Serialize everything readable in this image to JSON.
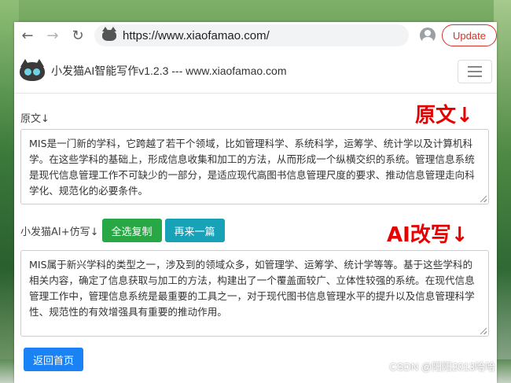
{
  "browser": {
    "back_icon": "←",
    "forward_icon": "→",
    "reload_icon": "↻",
    "url": "https://www.xiaofamao.com/",
    "update_label": "Update"
  },
  "site": {
    "brand": "小发猫AI智能写作v1.2.3 --- www.xiaofamao.com"
  },
  "original": {
    "label": "原文↓",
    "big_label": "原文↓",
    "text": "MIS是一门新的学科，它跨越了若干个领域，比如管理科学、系统科学，运筹学、统计学以及计算机科学。在这些学科的基础上，形成信息收集和加工的方法，从而形成一个纵横交织的系统。管理信息系统是现代信息管理工作不可缺少的一部分，是适应现代高图书信息管理尺度的要求、推动信息管理走向科学化、规范化的必要条件。"
  },
  "rewrite": {
    "label": "小发猫AI+仿写↓",
    "copy_all_label": "全选复制",
    "again_label": "再来一篇",
    "big_label": "AI改写↓",
    "text": "MIS属于新兴学科的类型之一，涉及到的领域众多，如管理学、运筹学、统计学等等。基于这些学科的相关内容，确定了信息获取与加工的方法，构建出了一个覆盖面较广、立体性较强的系统。在现代信息管理工作中，管理信息系统是最重要的工具之一，对于现代图书信息管理水平的提升以及信息管理科学性、规范性的有效增强具有重要的推动作用。"
  },
  "footer": {
    "back_home_label": "返回首页"
  },
  "watermark": "CSDN @阳阳2013哈哈",
  "colors": {
    "accent_red": "#e60000",
    "btn_green": "#28a745",
    "btn_teal": "#17a2b8",
    "btn_blue": "#1a82f5"
  }
}
